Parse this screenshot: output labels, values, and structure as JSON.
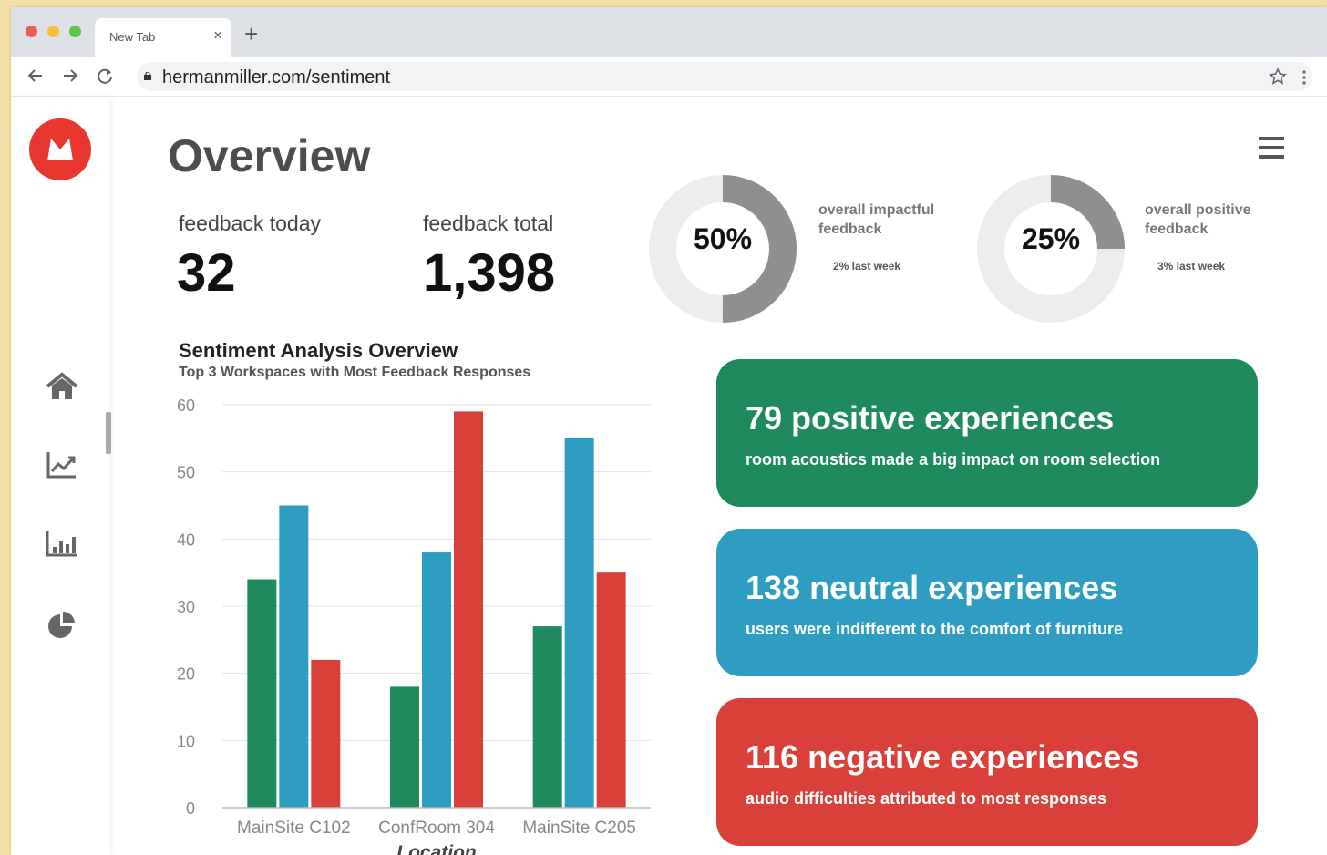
{
  "browser": {
    "tab_title": "New Tab",
    "tab_close": "×",
    "new_tab": "+",
    "url": "hermanmiller.com/sentiment"
  },
  "sidebar": {
    "items": [
      {
        "icon": "home-icon"
      },
      {
        "icon": "trend-chart-icon"
      },
      {
        "icon": "bar-chart-icon"
      },
      {
        "icon": "pie-chart-icon"
      }
    ]
  },
  "header": {
    "title": "Overview"
  },
  "stats": {
    "today_label": "feedback today",
    "today_value": "32",
    "total_label": "feedback total",
    "total_value": "1,398"
  },
  "donuts": [
    {
      "pct_text": "50%",
      "value": 0.5,
      "label": "overall impactful feedback",
      "delta": "2% last week"
    },
    {
      "pct_text": "25%",
      "value": 0.25,
      "label": "overall positive feedback",
      "delta": "3% last week"
    }
  ],
  "colors": {
    "positive": "#1f8a5e",
    "neutral": "#2f9dc2",
    "negative": "#d9403a",
    "donut_fill": "#8f8f8f",
    "donut_track": "#ececec",
    "brand": "#e8372f"
  },
  "chart_data": {
    "type": "bar",
    "title": "Sentiment Analysis Overview",
    "subtitle": "Top 3 Workspaces with Most Feedback Responses",
    "xlabel": "Location",
    "ylabel": "",
    "categories": [
      "MainSite C102",
      "ConfRoom 304",
      "MainSite C205"
    ],
    "series": [
      {
        "values": [
          34,
          18,
          27
        ],
        "color": "#1f8a5e"
      },
      {
        "values": [
          45,
          38,
          55
        ],
        "color": "#2f9dc2"
      },
      {
        "values": [
          22,
          59,
          35
        ],
        "color": "#d9403a"
      }
    ],
    "ylim": [
      0,
      60
    ],
    "yticks": [
      0,
      10,
      20,
      30,
      40,
      50,
      60
    ],
    "grid": true,
    "legend": "none"
  },
  "cards": [
    {
      "title": "79 positive experiences",
      "desc": "room acoustics made a big impact on room selection",
      "color": "#1f8a5e"
    },
    {
      "title": "138 neutral experiences",
      "desc": "users were indifferent to the comfort of furniture",
      "color": "#2f9dc2"
    },
    {
      "title": "116 negative experiences",
      "desc": "audio difficulties attributed to most responses",
      "color": "#d9403a"
    }
  ]
}
